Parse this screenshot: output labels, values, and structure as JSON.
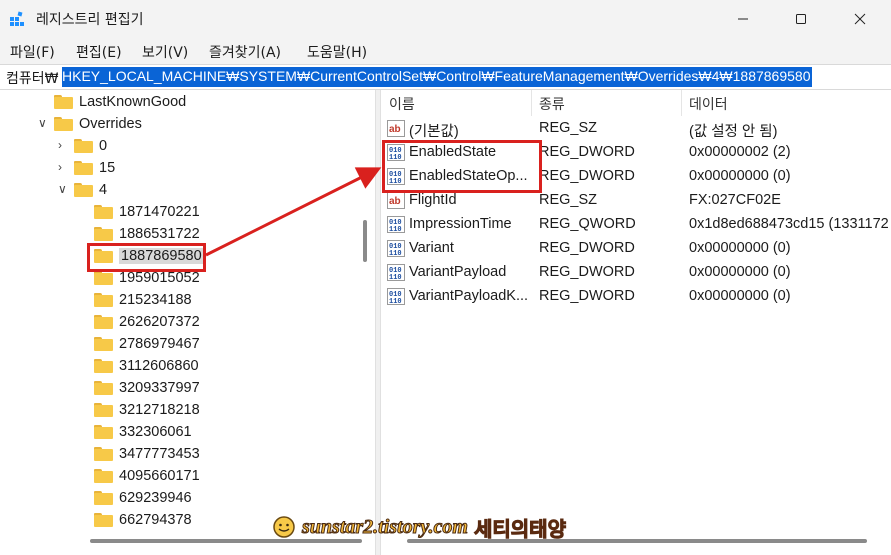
{
  "window": {
    "title": "레지스트리 편집기",
    "icon": "registry-editor-icon",
    "controls": {
      "minimize_icon": "minimize-icon",
      "maximize_icon": "maximize-icon",
      "close_icon": "close-icon"
    }
  },
  "menu": {
    "file": "파일(F)",
    "edit": "편집(E)",
    "view": "보기(V)",
    "favorites": "즐겨찾기(A)",
    "help": "도움말(H)"
  },
  "address": {
    "prefix": "컴퓨터₩",
    "path": "HKEY_LOCAL_MACHINE₩SYSTEM₩CurrentControlSet₩Control₩FeatureManagement₩Overrides₩4₩1887869580"
  },
  "tree": {
    "items": [
      {
        "label": "LastKnownGood",
        "level": 1,
        "expander": "none"
      },
      {
        "label": "Overrides",
        "level": 1,
        "expander": "expanded"
      },
      {
        "label": "0",
        "level": 2,
        "expander": "collapsed"
      },
      {
        "label": "15",
        "level": 2,
        "expander": "collapsed"
      },
      {
        "label": "4",
        "level": 2,
        "expander": "expanded"
      },
      {
        "label": "1871470221",
        "level": 3,
        "expander": "none"
      },
      {
        "label": "1886531722",
        "level": 3,
        "expander": "none"
      },
      {
        "label": "1887869580",
        "level": 3,
        "expander": "none",
        "selected": true
      },
      {
        "label": "1959015052",
        "level": 3,
        "expander": "none"
      },
      {
        "label": "215234188",
        "level": 3,
        "expander": "none"
      },
      {
        "label": "2626207372",
        "level": 3,
        "expander": "none"
      },
      {
        "label": "2786979467",
        "level": 3,
        "expander": "none"
      },
      {
        "label": "3112606860",
        "level": 3,
        "expander": "none"
      },
      {
        "label": "3209337997",
        "level": 3,
        "expander": "none"
      },
      {
        "label": "3212718218",
        "level": 3,
        "expander": "none"
      },
      {
        "label": "332306061",
        "level": 3,
        "expander": "none"
      },
      {
        "label": "3477773453",
        "level": 3,
        "expander": "none"
      },
      {
        "label": "4095660171",
        "level": 3,
        "expander": "none"
      },
      {
        "label": "629239946",
        "level": 3,
        "expander": "none"
      },
      {
        "label": "662794378",
        "level": 3,
        "expander": "none"
      }
    ]
  },
  "values": {
    "headers": {
      "name": "이름",
      "type": "종류",
      "data": "데이터"
    },
    "rows": [
      {
        "name": "(기본값)",
        "type": "REG_SZ",
        "data": "(값 설정 안 됨)",
        "icon": "string-value-icon"
      },
      {
        "name": "EnabledState",
        "type": "REG_DWORD",
        "data": "0x00000002 (2)",
        "icon": "binary-value-icon"
      },
      {
        "name": "EnabledStateOp...",
        "type": "REG_DWORD",
        "data": "0x00000000 (0)",
        "icon": "binary-value-icon"
      },
      {
        "name": "FlightId",
        "type": "REG_SZ",
        "data": "FX:027CF02E",
        "icon": "string-value-icon"
      },
      {
        "name": "ImpressionTime",
        "type": "REG_QWORD",
        "data": "0x1d8ed688473cd15 (1331172",
        "icon": "binary-value-icon"
      },
      {
        "name": "Variant",
        "type": "REG_DWORD",
        "data": "0x00000000 (0)",
        "icon": "binary-value-icon"
      },
      {
        "name": "VariantPayload",
        "type": "REG_DWORD",
        "data": "0x00000000 (0)",
        "icon": "binary-value-icon"
      },
      {
        "name": "VariantPayloadK...",
        "type": "REG_DWORD",
        "data": "0x00000000 (0)",
        "icon": "binary-value-icon"
      }
    ]
  },
  "watermark": {
    "url": "sunstar2.tistory.com",
    "brand": "세티의태양"
  },
  "colors": {
    "selection": "#0a64d6",
    "annotation": "#d9211e",
    "folder": "#f7c948"
  }
}
